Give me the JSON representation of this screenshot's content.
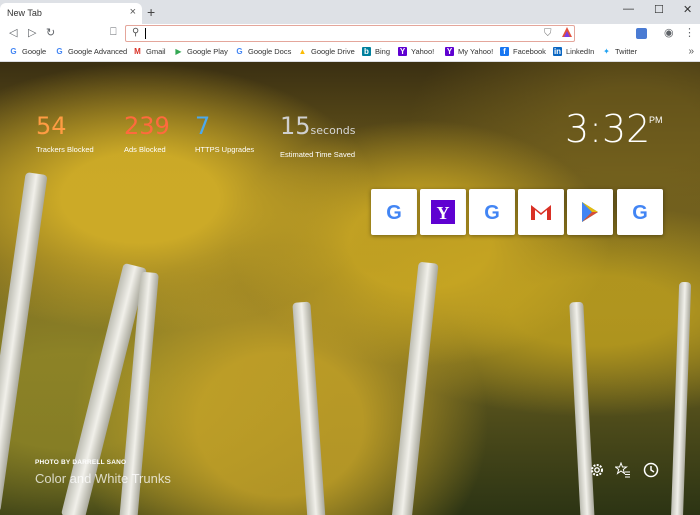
{
  "tab": {
    "title": "New Tab",
    "close": "×",
    "new_tab": "+"
  },
  "window": {
    "minimize": "—",
    "maximize": "☐",
    "close": "✕"
  },
  "toolbar": {
    "omnibox_value": "",
    "menu": "⋮"
  },
  "bookmarks": [
    {
      "label": "Google",
      "icon": "google-favicon",
      "color": "#4285f4"
    },
    {
      "label": "Google Advanced",
      "icon": "google-favicon",
      "color": "#4285f4"
    },
    {
      "label": "Gmail",
      "icon": "gmail-favicon",
      "color": "#d93025"
    },
    {
      "label": "Google Play",
      "icon": "play-favicon",
      "color": "#34a853"
    },
    {
      "label": "Google Docs",
      "icon": "google-favicon",
      "color": "#4285f4"
    },
    {
      "label": "Google Drive",
      "icon": "drive-favicon",
      "color": "#fbbc05"
    },
    {
      "label": "Bing",
      "icon": "bing-favicon",
      "color": "#00809d"
    },
    {
      "label": "Yahoo!",
      "icon": "yahoo-favicon",
      "color": "#5f01d1"
    },
    {
      "label": "My Yahoo!",
      "icon": "yahoo-favicon",
      "color": "#5f01d1"
    },
    {
      "label": "Facebook",
      "icon": "facebook-favicon",
      "color": "#1877f2"
    },
    {
      "label": "LinkedIn",
      "icon": "linkedin-favicon",
      "color": "#0a66c2"
    },
    {
      "label": "Twitter",
      "icon": "twitter-favicon",
      "color": "#1da1f2"
    }
  ],
  "stats": {
    "trackers": {
      "value": "54",
      "label": "Trackers Blocked",
      "color": "#ff9c43"
    },
    "ads": {
      "value": "239",
      "label": "Ads Blocked",
      "color": "#ff6a3d"
    },
    "https": {
      "value": "7",
      "label": "HTTPS Upgrades",
      "color": "#4ca9ee"
    },
    "time": {
      "value": "15",
      "unit": "seconds",
      "label": "Estimated Time Saved",
      "color": "#cfcfcf"
    }
  },
  "clock": {
    "time": "3:32",
    "ampm": "PM"
  },
  "top_sites": [
    "Google",
    "Yahoo",
    "Google",
    "Gmail",
    "Google Play",
    "Google"
  ],
  "footer": {
    "credit": "PHOTO BY DARRELL SANO",
    "photo_title": "Color and White Trunks"
  }
}
